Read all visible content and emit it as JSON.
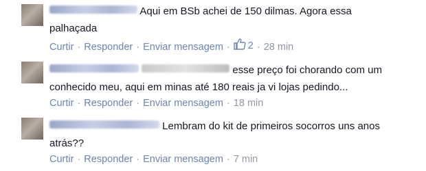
{
  "comments": [
    {
      "text": "Aqui em BSb achei de 150 dilmas. Agora essa palhaçada",
      "actions": {
        "like": "Curtir",
        "reply": "Responder",
        "message": "Enviar mensagem"
      },
      "likes": "2",
      "time": "28 min"
    },
    {
      "text": "esse preço foi chorando com um conhecido meu, aqui em minas até 180 reais ja vi lojas pedindo...",
      "actions": {
        "like": "Curtir",
        "reply": "Responder",
        "message": "Enviar mensagem"
      },
      "time": "18 min"
    },
    {
      "text": "Lembram do kit de primeiros socorros uns anos atrás??",
      "actions": {
        "like": "Curtir",
        "reply": "Responder",
        "message": "Enviar mensagem"
      },
      "time": "7 min"
    }
  ],
  "icons": {
    "like_count_icon": "thumbs-up-icon"
  },
  "colors": {
    "link": "#6d84b4",
    "meta": "#9197a3",
    "text": "#141823"
  }
}
